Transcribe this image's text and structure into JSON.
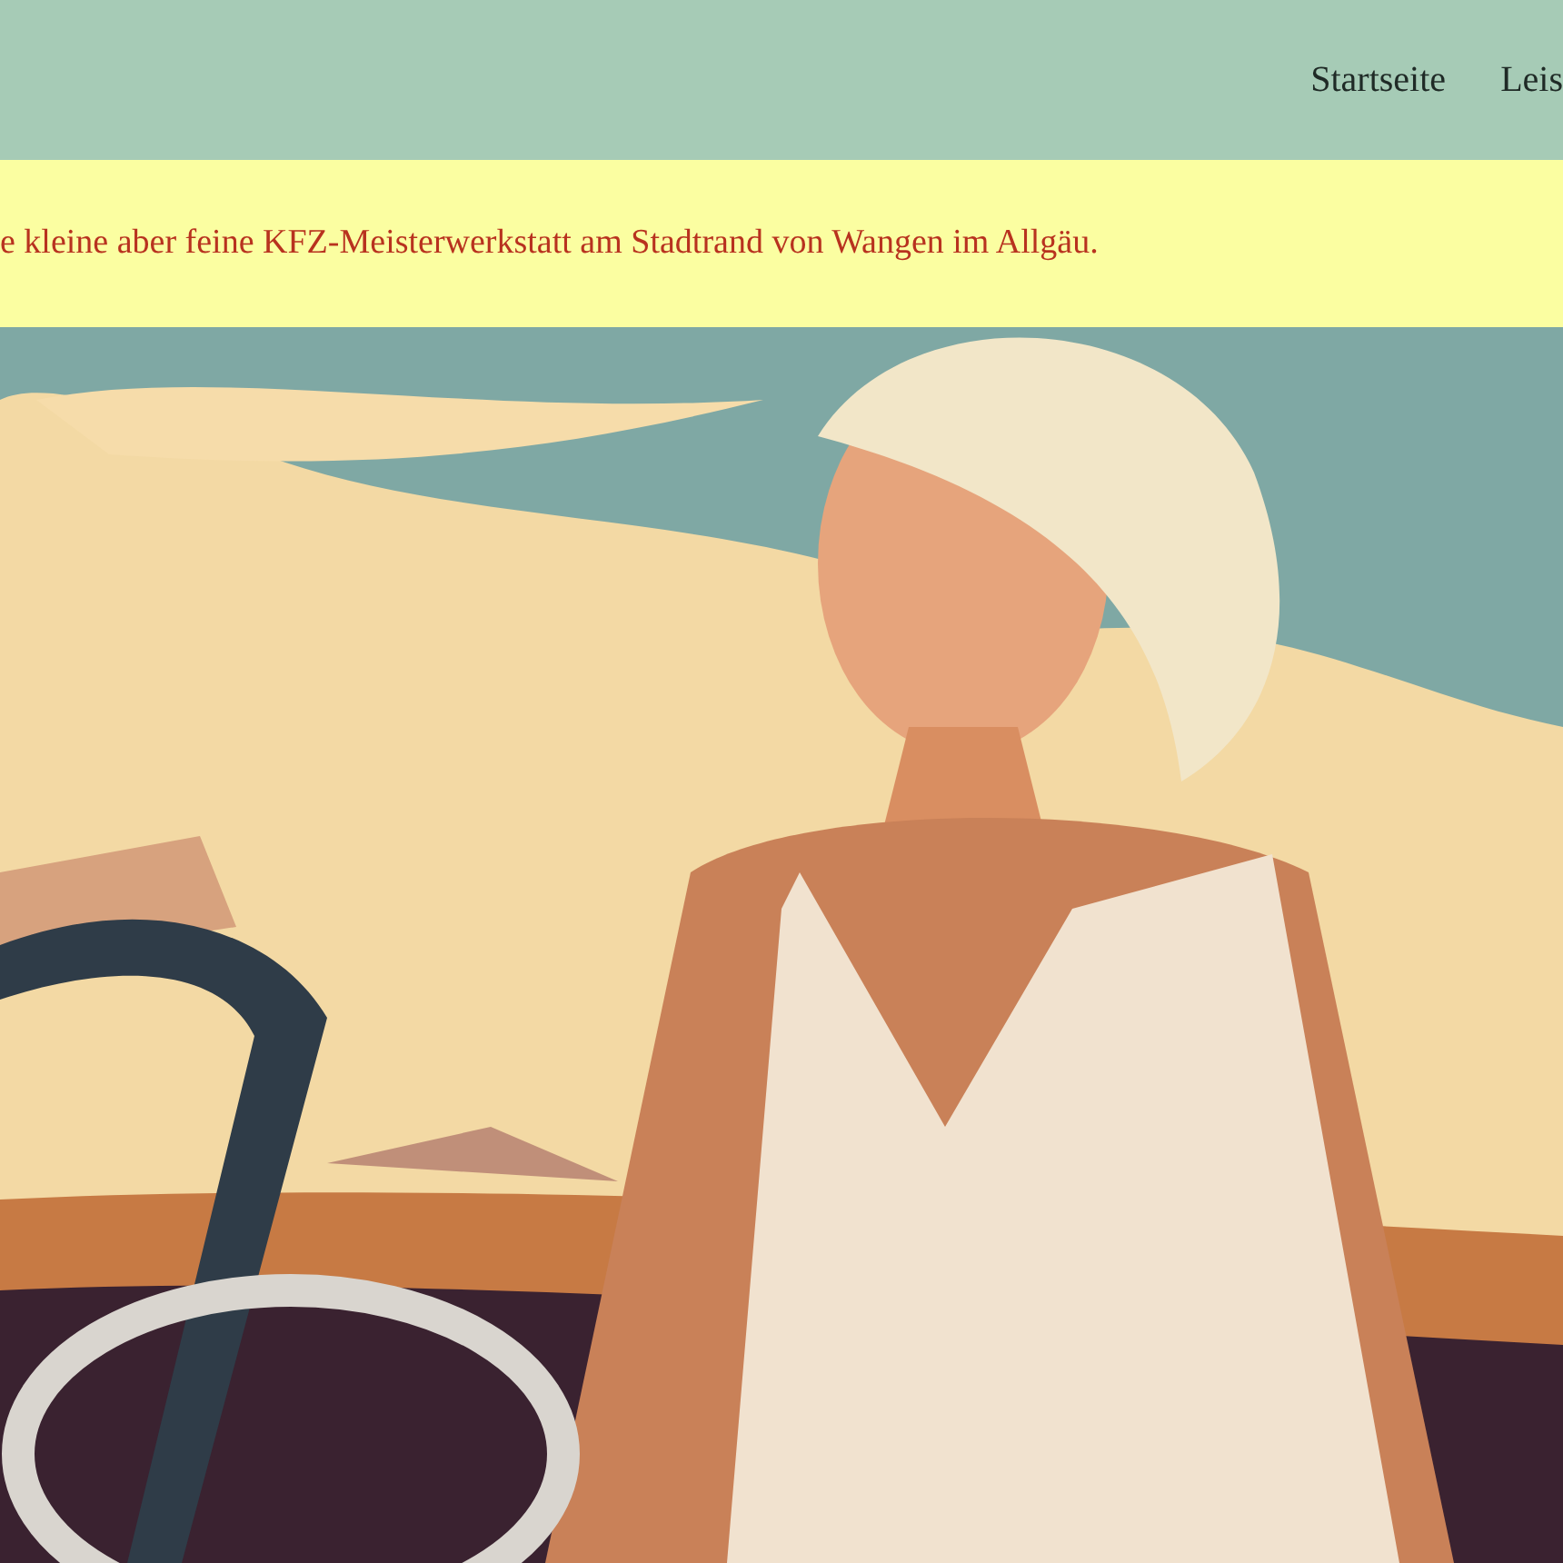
{
  "nav": {
    "items": [
      {
        "label": "Startseite"
      },
      {
        "label": "Leis"
      }
    ]
  },
  "banner": {
    "text": "e kleine aber feine KFZ-Meisterwerkstatt am Stadtrand von Wangen im Allgäu."
  }
}
